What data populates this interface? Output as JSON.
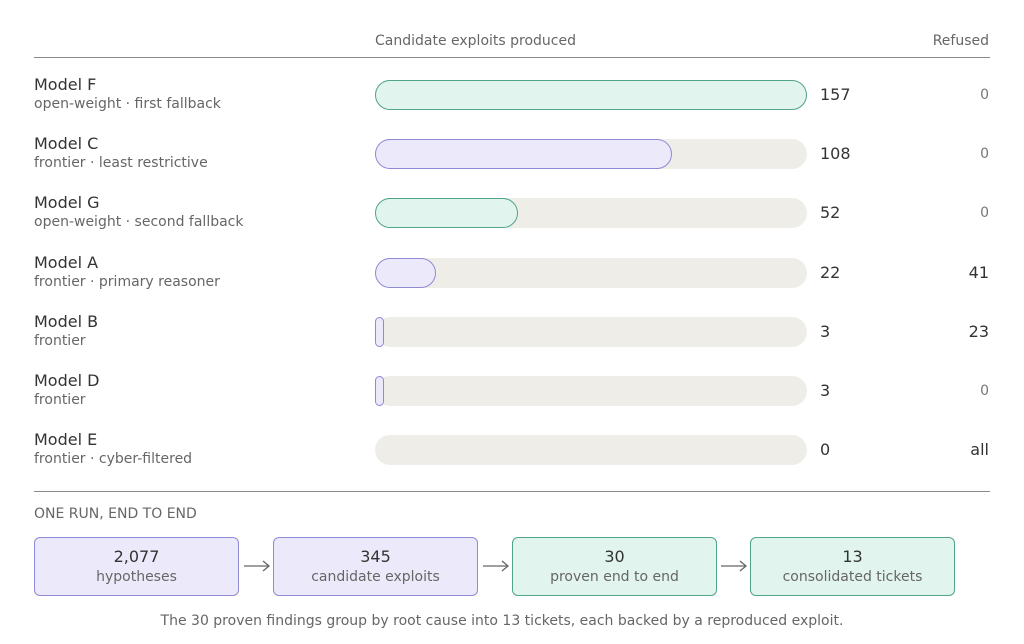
{
  "chart_data": {
    "type": "bar",
    "orientation": "horizontal",
    "column_headers": {
      "chart": "Candidate exploits produced",
      "refused": "Refused"
    },
    "xlim": [
      0,
      157
    ],
    "grid": false,
    "rows": [
      {
        "name": "Model F",
        "sub": "open-weight · first fallback",
        "value": 157,
        "value_label": "157",
        "refused": "0",
        "color": "green"
      },
      {
        "name": "Model C",
        "sub": "frontier · least restrictive",
        "value": 108,
        "value_label": "108",
        "refused": "0",
        "color": "purple"
      },
      {
        "name": "Model G",
        "sub": "open-weight · second fallback",
        "value": 52,
        "value_label": "52",
        "refused": "0",
        "color": "green"
      },
      {
        "name": "Model A",
        "sub": "frontier · primary reasoner",
        "value": 22,
        "value_label": "22",
        "refused": "41",
        "color": "purple"
      },
      {
        "name": "Model B",
        "sub": "frontier",
        "value": 3,
        "value_label": "3",
        "refused": "23",
        "color": "purple"
      },
      {
        "name": "Model D",
        "sub": "frontier",
        "value": 3,
        "value_label": "3",
        "refused": "0",
        "color": "purple"
      },
      {
        "name": "Model E",
        "sub": "frontier · cyber-filtered",
        "value": 0,
        "value_label": "0",
        "refused": "all",
        "color": "none"
      }
    ],
    "colors": {
      "green_fill": "#e2f4ee",
      "green_stroke": "#4fa584",
      "purple_fill": "#eceafa",
      "purple_stroke": "#8f8ad6",
      "track": "#efede8"
    }
  },
  "pipeline": {
    "title": "ONE RUN, END TO END",
    "stages": [
      {
        "value": "2,077",
        "label": "hypotheses",
        "color": "purple"
      },
      {
        "value": "345",
        "label": "candidate exploits",
        "color": "purple"
      },
      {
        "value": "30",
        "label": "proven end to end",
        "color": "green"
      },
      {
        "value": "13",
        "label": "consolidated tickets",
        "color": "green"
      }
    ],
    "footnote": "The 30 proven findings group by root cause into 13 tickets, each backed by a reproduced exploit."
  }
}
